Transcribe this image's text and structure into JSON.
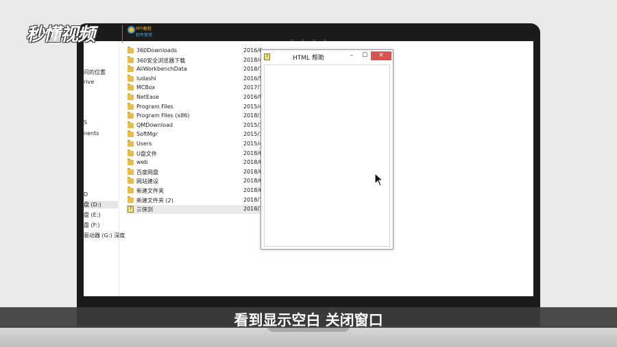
{
  "logo": {
    "text": "秒懂视频",
    "badge_line1": "PPT教程",
    "badge_line2": "软件使用"
  },
  "nav_pane": {
    "items": [
      {
        "label": "问的位置"
      },
      {
        "label": "rive"
      },
      {
        "label": "S"
      },
      {
        "label": "nents"
      },
      {
        "label": "D"
      },
      {
        "label": "盘 (D:)"
      },
      {
        "label": "盘 (E:)"
      },
      {
        "label": "盘 (F:)"
      },
      {
        "label": "驱动器 (G:) 深度"
      }
    ]
  },
  "file_list": {
    "rows": [
      {
        "name": "360Downloads",
        "date": "2016/6",
        "icon": "folder-icon"
      },
      {
        "name": "360安全浏览器下载",
        "date": "2018/4",
        "icon": "folder-icon"
      },
      {
        "name": "AliWorkbenchData",
        "date": "2018/7",
        "icon": "folder-icon"
      },
      {
        "name": "ludashi",
        "date": "2016/5",
        "icon": "folder-icon"
      },
      {
        "name": "MCBox",
        "date": "2017/7",
        "icon": "folder-icon"
      },
      {
        "name": "NetEase",
        "date": "2016/9",
        "icon": "folder-icon"
      },
      {
        "name": "Program Files",
        "date": "2015/4",
        "icon": "folder-icon"
      },
      {
        "name": "Program Files (x86)",
        "date": "2018/3",
        "icon": "folder-icon"
      },
      {
        "name": "QMDownload",
        "date": "2015/1",
        "icon": "folder-icon"
      },
      {
        "name": "SoftMgr",
        "date": "2015/1",
        "icon": "folder-icon"
      },
      {
        "name": "Users",
        "date": "2015/4",
        "icon": "folder-icon"
      },
      {
        "name": "U盘文件",
        "date": "2018/6",
        "icon": "folder-icon"
      },
      {
        "name": "web",
        "date": "2018/6",
        "icon": "folder-icon"
      },
      {
        "name": "百度网盘",
        "date": "2018/6",
        "icon": "folder-icon"
      },
      {
        "name": "网站建设",
        "date": "2018/6",
        "icon": "folder-icon"
      },
      {
        "name": "新建文件夹",
        "date": "2018/6",
        "icon": "folder-icon"
      },
      {
        "name": "新建文件夹 (2)",
        "date": "2018/7",
        "icon": "folder-icon"
      },
      {
        "name": "三侠剑",
        "date": "2018/7",
        "icon": "chm-file-icon"
      }
    ]
  },
  "help_window": {
    "title": "HTML 帮助",
    "minimize": "–",
    "maximize": "☐",
    "close": "✕",
    "close_color": "#d9534f"
  },
  "subtitle": {
    "text": "看到显示空白 关闭窗口"
  }
}
